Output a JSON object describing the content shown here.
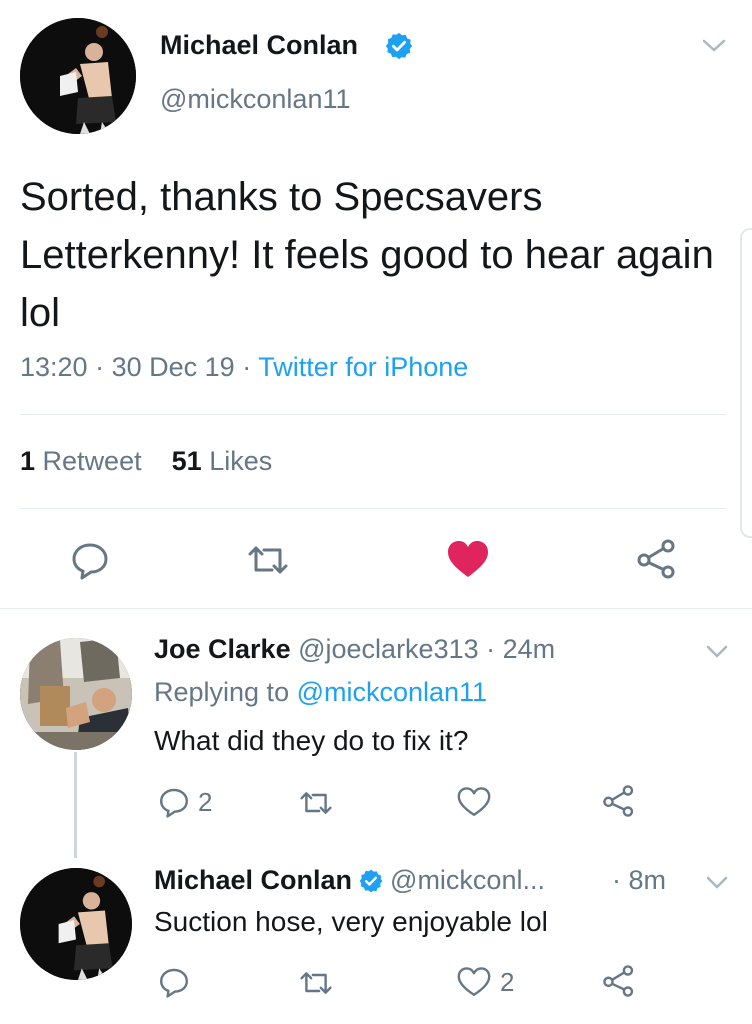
{
  "main_tweet": {
    "author_name": "Michael Conlan",
    "author_handle": "@mickconlan11",
    "text": "Sorted, thanks to Specsavers Letterkenny! It feels good to hear again lol",
    "time": "13:20",
    "date": "30 Dec 19",
    "source": "Twitter for iPhone",
    "separator": "·",
    "retweet_count": "1",
    "retweet_label": "Retweet",
    "like_count": "51",
    "like_label": "Likes",
    "liked": true
  },
  "replies": [
    {
      "author_name": "Joe Clarke",
      "author_handle": "@joeclarke313",
      "age": "· 24m",
      "replying_prefix": "Replying to",
      "replying_to": "@mickconlan11",
      "text": "What did they do to fix it?",
      "reply_count": "2",
      "retweet_count": "",
      "like_count": ""
    },
    {
      "author_name": "Michael Conlan",
      "author_handle": "@mickconl...",
      "age": "· 8m",
      "text": "Suction hose, very enjoyable lol",
      "reply_count": "",
      "retweet_count": "",
      "like_count": "2",
      "verified": true
    }
  ],
  "colors": {
    "accent": "#1da1f2",
    "like": "#e0245e",
    "muted": "#657786",
    "icon": "#657786"
  },
  "icons": [
    "verified-badge-icon",
    "chevron-down-icon",
    "reply-icon",
    "retweet-icon",
    "like-icon",
    "share-icon"
  ]
}
